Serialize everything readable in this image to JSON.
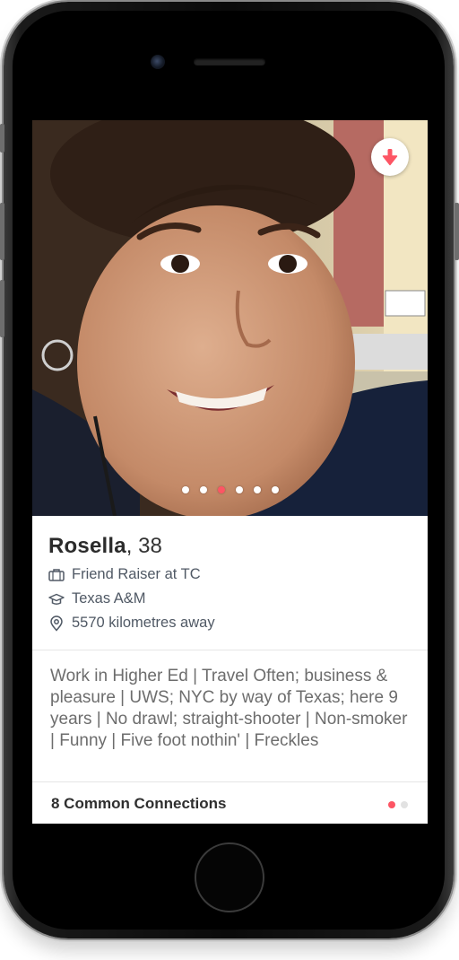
{
  "profile": {
    "name": "Rosella",
    "age_text": ", 38",
    "job": "Friend Raiser at TC",
    "school": "Texas A&M",
    "distance": "5570 kilometres away",
    "bio": "Work in Higher Ed | Travel Often; business & pleasure | UWS; NYC by way of Texas; here 9 years | No drawl; straight-shooter | Non-smoker | Funny | Five foot nothin' | Freckles"
  },
  "photo": {
    "count": 6,
    "active_index": 2,
    "icon": "person-photo"
  },
  "info_button": {
    "icon": "arrow-down-icon"
  },
  "footer": {
    "connections_label": "8 Common Connections",
    "page_count": 2,
    "active_page": 0
  },
  "colors": {
    "accent": "#fd5564",
    "text_dark": "#2b2b2b",
    "text_muted": "#6d6d6d"
  }
}
